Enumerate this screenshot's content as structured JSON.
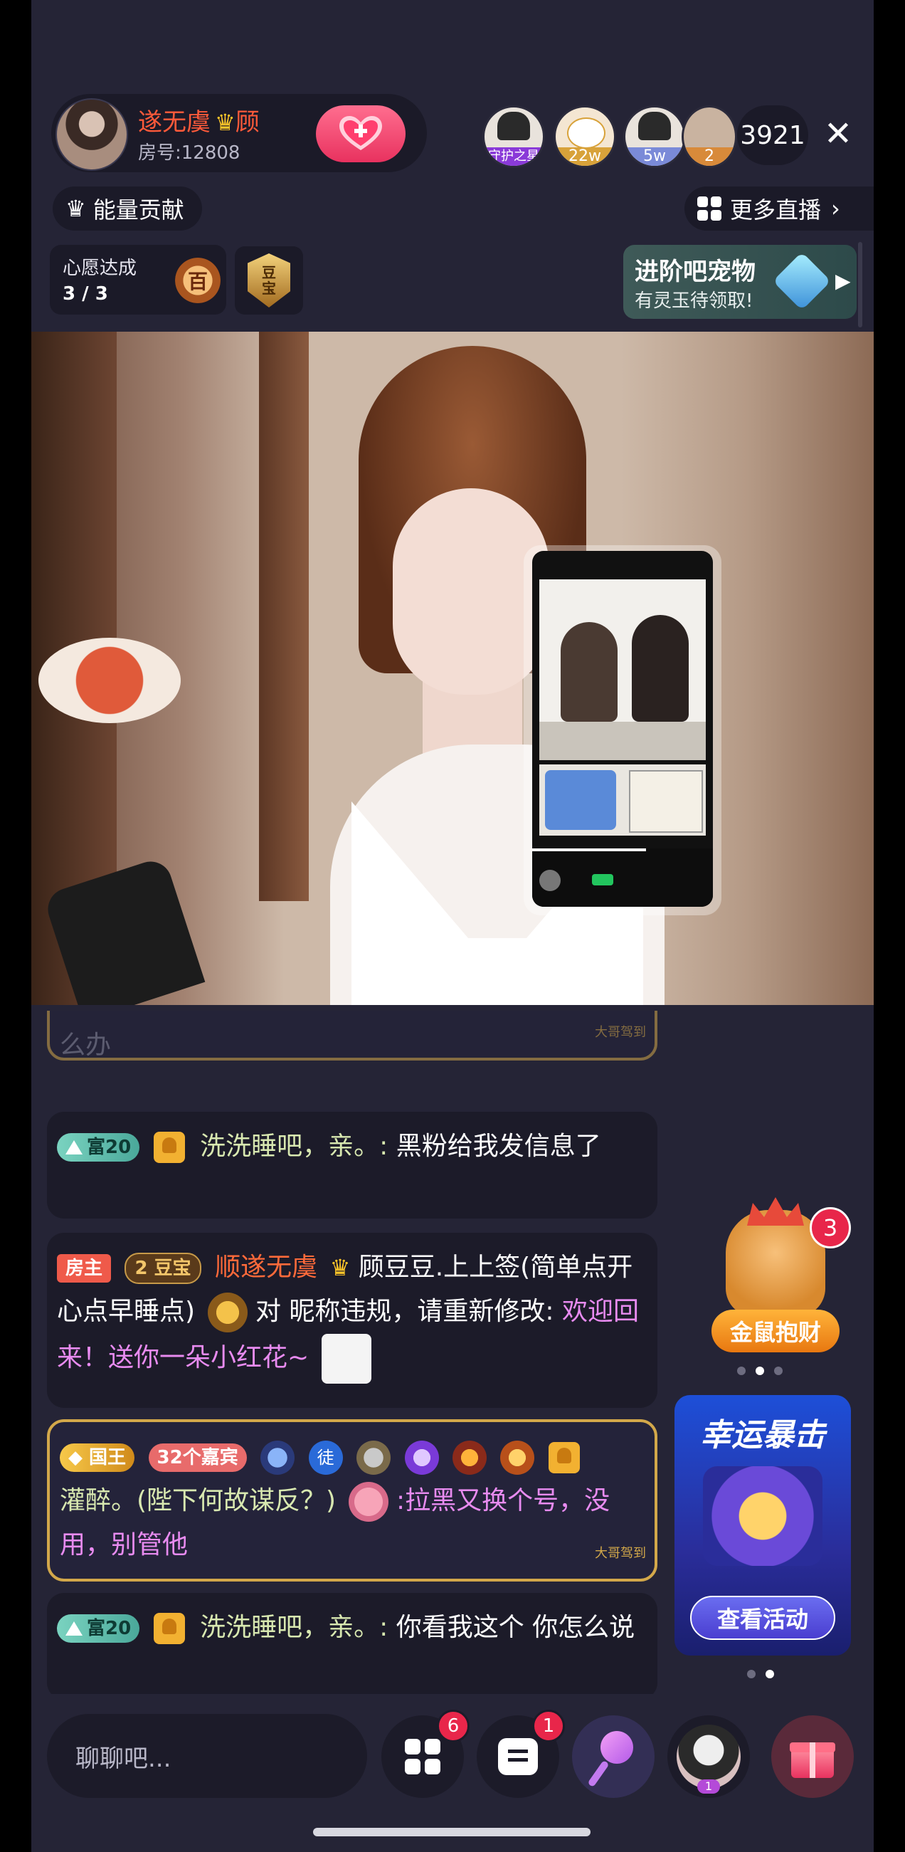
{
  "host": {
    "name": "遂无虞",
    "name_suffix": "顾",
    "room_label": "房号:12808"
  },
  "viewers": [
    {
      "tag": "守护之星",
      "tag_color": "#8a3ad8"
    },
    {
      "tag": "22w",
      "tag_color": "#d8a23a"
    },
    {
      "tag": "5w",
      "tag_color": "#7a8ad8"
    },
    {
      "tag": "2",
      "tag_color": "#d88a3a"
    }
  ],
  "viewer_count": "3921",
  "energy_label": "能量贡献",
  "more_live_label": "更多直播",
  "wish": {
    "title": "心愿达成",
    "count": "3 / 3",
    "badge_text": "百"
  },
  "doubao_badge": {
    "line1": "豆",
    "line2": "宝"
  },
  "pet_banner": {
    "title": "进阶吧宠物",
    "subtitle": "有灵玉待领取!"
  },
  "chat": {
    "partial_text": "么办",
    "messages": [
      {
        "level": "富20",
        "nick": "洗洗睡吧，亲。",
        "text": "黑粉给我发信息了"
      },
      {
        "host_badge": "房主",
        "fan_level": "2",
        "fan_name": "豆宝",
        "nick": "顺遂无虞",
        "nick_cont": "顾豆豆.上上签(简单点开心点早睡点)",
        "mid": "对",
        "target": "昵称违规，请重新修改:",
        "text": "欢迎回来！送你一朵小红花~"
      },
      {
        "rank_badge": "国王",
        "guest_count": "32",
        "guest_label": "个嘉宾",
        "tu_badge": "徒",
        "nick": "灌醉。(陛下何故谋反？)",
        "text": "拉黑又换个号，没用，别管他",
        "watermark": "大哥驾到"
      },
      {
        "level": "富20",
        "nick": "洗洗睡吧，亲。",
        "text": "你看我这个 你怎么说"
      }
    ],
    "top_watermark": "大哥驾到"
  },
  "rich_activity": {
    "label": "金鼠抱财",
    "count": "3"
  },
  "event": {
    "title": "幸运暴击",
    "button": "查看活动"
  },
  "bottom": {
    "input_placeholder": "聊聊吧...",
    "apps_count": "6",
    "msg_count": "1",
    "avatar_badge": "1"
  }
}
